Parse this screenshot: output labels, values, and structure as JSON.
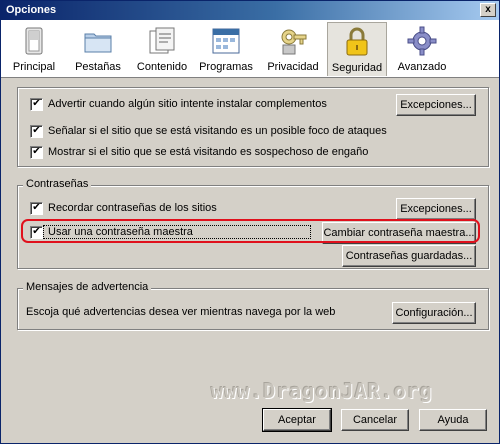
{
  "window": {
    "title": "Opciones",
    "close_glyph": "x"
  },
  "tabs": [
    {
      "label": "Principal",
      "icon": "switch-icon"
    },
    {
      "label": "Pestañas",
      "icon": "folder-tabs-icon"
    },
    {
      "label": "Contenido",
      "icon": "document-content-icon"
    },
    {
      "label": "Programas",
      "icon": "calendar-app-icon"
    },
    {
      "label": "Privacidad",
      "icon": "privacy-mask-icon"
    },
    {
      "label": "Seguridad",
      "icon": "padlock-icon",
      "active": true
    },
    {
      "label": "Avanzado",
      "icon": "gear-icon"
    }
  ],
  "security": {
    "addons_warn": {
      "label": "Advertir cuando algún sitio intente instalar complementos",
      "checked": true
    },
    "addons_exceptions": "Excepciones...",
    "attack_site": {
      "label": "Señalar si el sitio que se está visitando es un posible foco de ataques",
      "checked": true
    },
    "forgery_site": {
      "label": "Mostrar si el sitio que se está visitando es sospechoso de engaño",
      "checked": true
    }
  },
  "passwords": {
    "legend": "Contraseñas",
    "remember": {
      "label": "Recordar contraseñas de los sitios",
      "checked": true
    },
    "exceptions": "Excepciones...",
    "master": {
      "label": "Usar una contraseña maestra",
      "checked": true
    },
    "change_master": "Cambiar contraseña maestra...",
    "saved": "Contraseñas guardadas..."
  },
  "warnings": {
    "legend": "Mensajes de advertencia",
    "description": "Escoja qué advertencias desea ver mientras navega por la web",
    "config": "Configuración..."
  },
  "footer": {
    "ok": "Aceptar",
    "cancel": "Cancelar",
    "help": "Ayuda"
  },
  "watermark": "www.DragonJAR.org",
  "colors": {
    "highlight": "#e0101c",
    "title_bar": "#0a246a"
  }
}
